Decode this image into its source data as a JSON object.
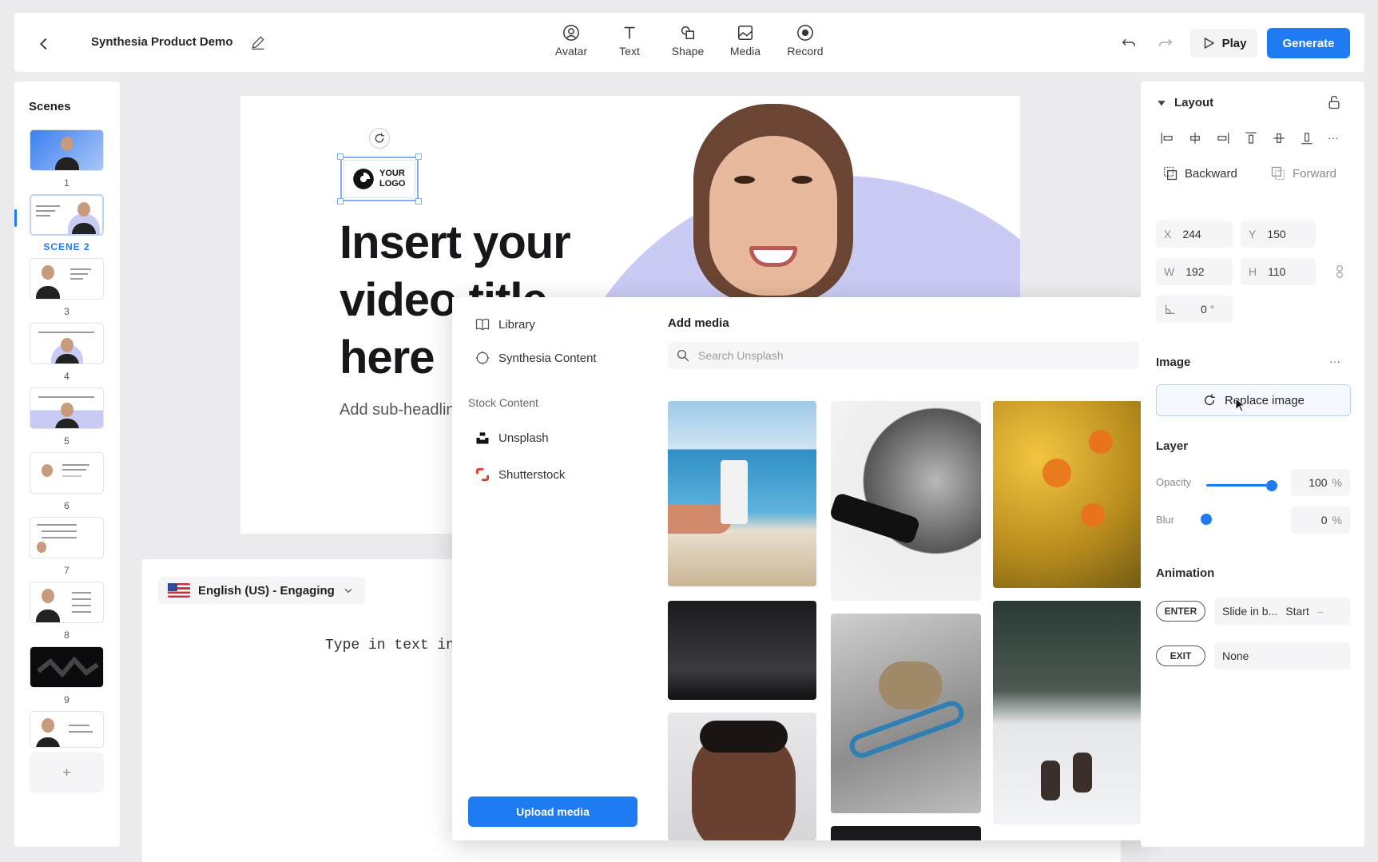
{
  "header": {
    "project_title": "Synthesia Product Demo",
    "tools": [
      {
        "label": "Avatar",
        "icon": "avatar-icon"
      },
      {
        "label": "Text",
        "icon": "text-icon"
      },
      {
        "label": "Shape",
        "icon": "shape-icon"
      },
      {
        "label": "Media",
        "icon": "media-icon"
      },
      {
        "label": "Record",
        "icon": "record-icon"
      }
    ],
    "play_label": "Play",
    "generate_label": "Generate",
    "accent_color": "#1f7bf2"
  },
  "scenes": {
    "title": "Scenes",
    "items": [
      {
        "label": "1"
      },
      {
        "label": "SCENE 2",
        "active": true
      },
      {
        "label": "3"
      },
      {
        "label": "4"
      },
      {
        "label": "5"
      },
      {
        "label": "6"
      },
      {
        "label": "7"
      },
      {
        "label": "8"
      },
      {
        "label": "9"
      },
      {
        "label": ""
      }
    ],
    "add_label": "+"
  },
  "canvas": {
    "logo_text_1": "YOUR",
    "logo_text_2": "LOGO",
    "headline_1": "Insert your",
    "headline_2": "video title",
    "headline_3": "here",
    "subheadline": "Add sub-headline"
  },
  "script": {
    "language": "English (US) - Engaging",
    "placeholder": "Type in text in"
  },
  "media_modal": {
    "library": "Library",
    "synthesia_content": "Synthesia Content",
    "stock_section": "Stock Content",
    "unsplash": "Unsplash",
    "shutterstock": "Shutterstock",
    "upload_label": "Upload media",
    "add_media_title": "Add media",
    "search_placeholder": "Search Unsplash"
  },
  "properties": {
    "layout_title": "Layout",
    "backward_label": "Backward",
    "forward_label": "Forward",
    "x_key": "X",
    "x_value": "244",
    "y_key": "Y",
    "y_value": "150",
    "w_key": "W",
    "w_value": "192",
    "h_key": "H",
    "h_value": "110",
    "rotation_value": "0",
    "rotation_unit": "°",
    "image_title": "Image",
    "replace_label": "Replace image",
    "layer_title": "Layer",
    "opacity_label": "Opacity",
    "opacity_value": "100",
    "opacity_fraction": 1.0,
    "blur_label": "Blur",
    "blur_value": "0",
    "blur_fraction": 0.0,
    "percent": "%",
    "animation_title": "Animation",
    "enter_tag": "ENTER",
    "enter_value": "Slide in b...",
    "enter_start": "Start",
    "exit_tag": "EXIT",
    "exit_value": "None",
    "more": "···"
  }
}
